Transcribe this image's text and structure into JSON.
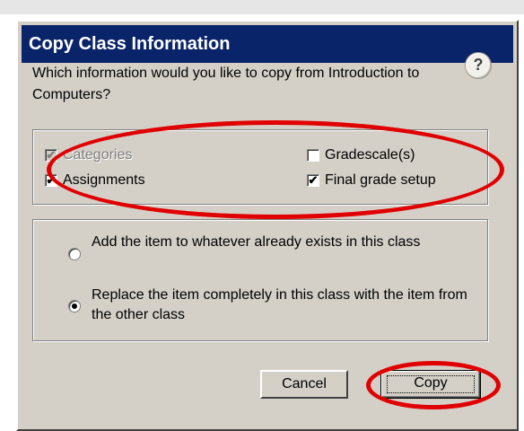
{
  "dialog": {
    "title": "Copy Class Information",
    "help_glyph": "?",
    "question": "Which information would you like to copy from Introduction to Computers?"
  },
  "checkboxes": [
    {
      "label": "Categories",
      "checked": true,
      "disabled": true
    },
    {
      "label": "Assignments",
      "checked": true,
      "disabled": false
    },
    {
      "label": "Gradescale(s)",
      "checked": false,
      "disabled": false
    },
    {
      "label": "Final grade setup",
      "checked": true,
      "disabled": false
    }
  ],
  "radios": [
    {
      "label": "Add the item to whatever already exists in this class",
      "selected": false
    },
    {
      "label": "Replace the item completely in this class with the item from the other class",
      "selected": true
    }
  ],
  "buttons": {
    "cancel": "Cancel",
    "copy": "Copy"
  },
  "colors": {
    "titlebar": "#0a246a",
    "dialog_bg": "#d4d0c8",
    "annotation": "#e00000"
  },
  "icons": {
    "help": "help-icon",
    "check": "checkmark-icon"
  }
}
